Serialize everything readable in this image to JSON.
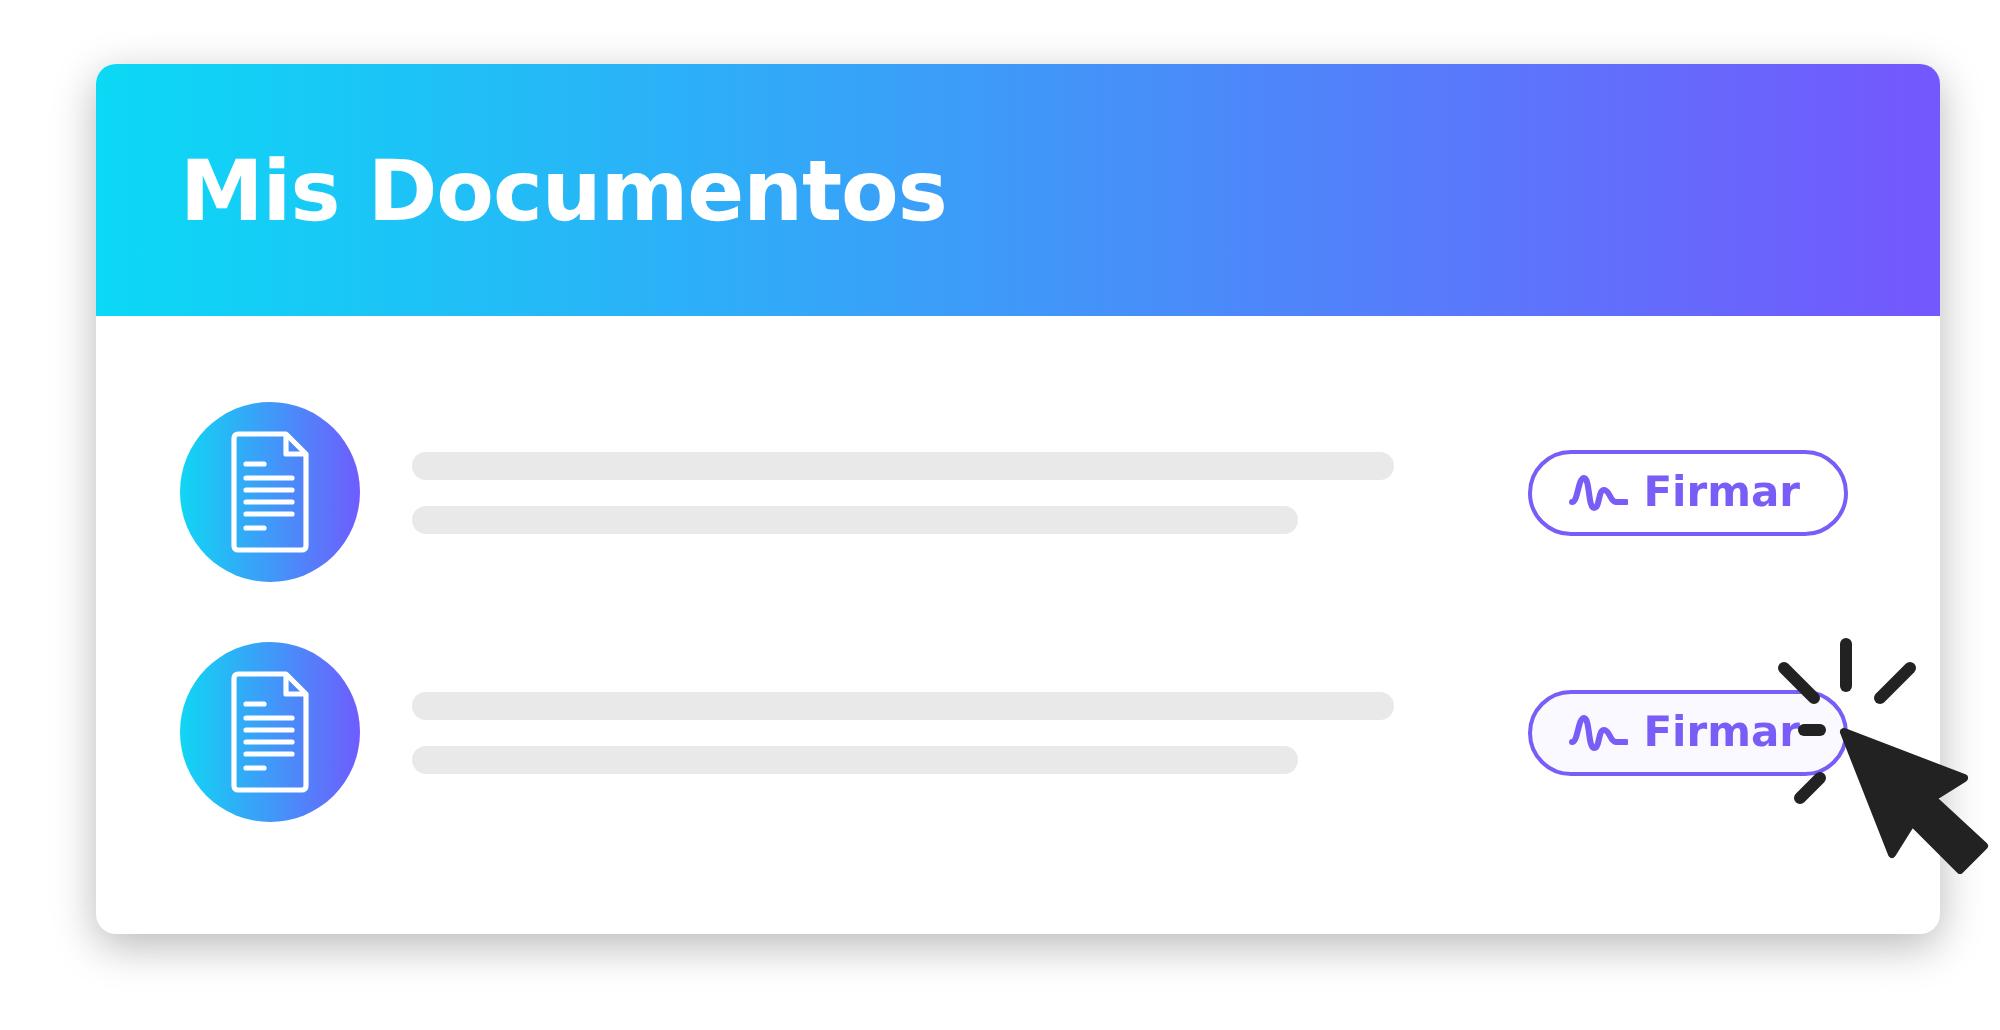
{
  "header": {
    "title": "Mis Documentos"
  },
  "documents": [
    {
      "button": "Firmar",
      "pressed": false
    },
    {
      "button": "Firmar",
      "pressed": true
    }
  ]
}
